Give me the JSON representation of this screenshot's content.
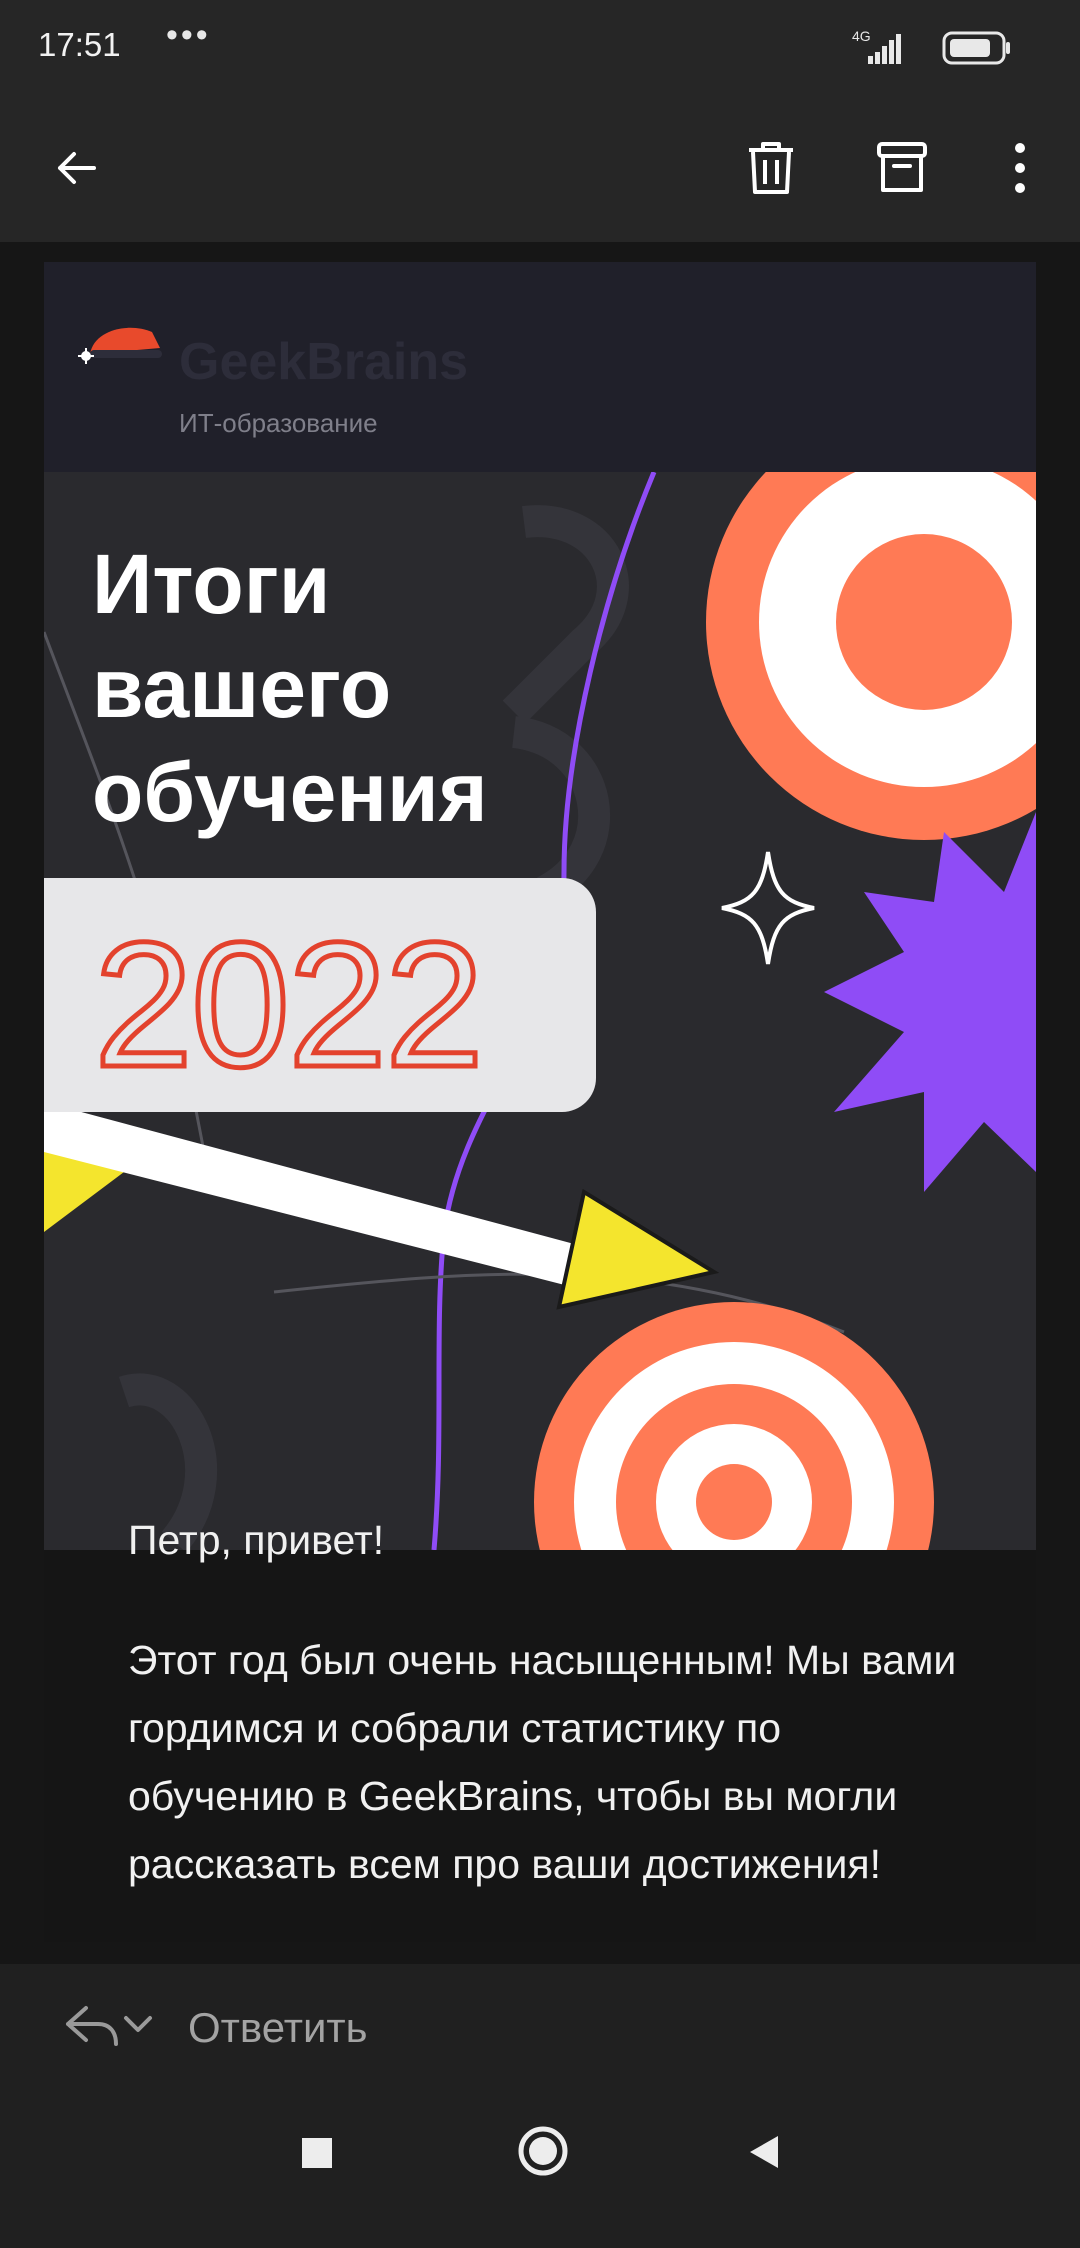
{
  "status_bar": {
    "time": "17:51",
    "dots": "•••",
    "network": "4G",
    "icons": [
      "signal-icon",
      "battery-icon"
    ]
  },
  "app_bar": {
    "icons": [
      "back-arrow-icon",
      "trash-icon",
      "archive-icon",
      "more-vert-icon"
    ]
  },
  "email": {
    "logo": {
      "name": "GeekBrains",
      "subtitle": "ИТ-образование"
    },
    "banner": {
      "title_lines": [
        "Итоги",
        "вашего",
        "обучения"
      ],
      "year": "2022"
    },
    "greeting": "Петр, привет!",
    "paragraph": "Этот год был очень насыщенным! Мы вами гордимся и собрали статистику по обучению в GeekBrains, чтобы вы могли рассказать всем про ваши достижения!"
  },
  "reply_bar": {
    "reply_label": "Ответить",
    "icons": [
      "reply-icon",
      "chevron-down-icon"
    ]
  },
  "nav_bar": {
    "icons": [
      "recents-square-icon",
      "home-circle-icon",
      "back-triangle-icon"
    ]
  },
  "colors": {
    "accent_orange": "#ff7a55",
    "accent_purple": "#8f4cf6",
    "accent_yellow": "#f4e52d",
    "year_red": "#e3422d"
  }
}
